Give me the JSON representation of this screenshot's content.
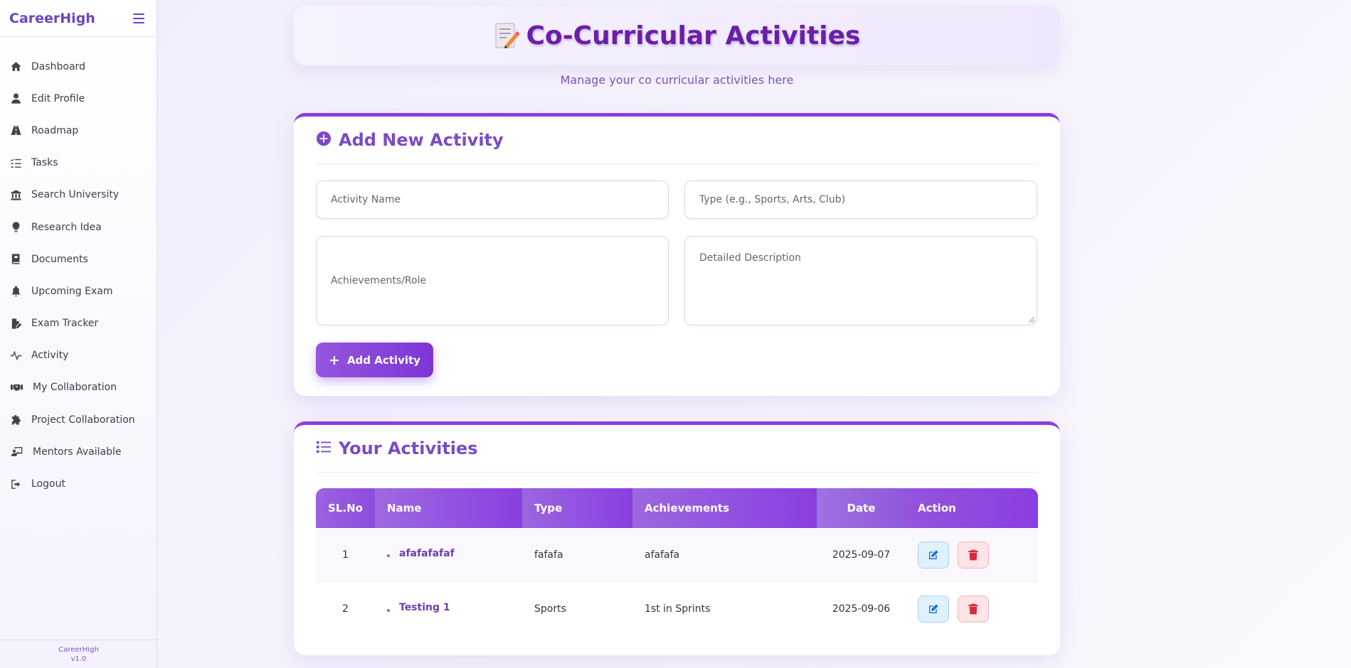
{
  "app": {
    "brand": "CareerHigh",
    "footer_name": "CareerHigh",
    "footer_version": "v1.0"
  },
  "sidebar": {
    "items": [
      {
        "label": "Dashboard",
        "icon": "home-icon"
      },
      {
        "label": "Edit Profile",
        "icon": "user-icon"
      },
      {
        "label": "Roadmap",
        "icon": "road-icon"
      },
      {
        "label": "Tasks",
        "icon": "list-check-icon"
      },
      {
        "label": "Search University",
        "icon": "university-icon"
      },
      {
        "label": "Research Idea",
        "icon": "lightbulb-icon"
      },
      {
        "label": "Documents",
        "icon": "book-icon"
      },
      {
        "label": "Upcoming Exam",
        "icon": "bell-icon"
      },
      {
        "label": "Exam Tracker",
        "icon": "file-signature-icon"
      },
      {
        "label": "Activity",
        "icon": "pulse-icon"
      },
      {
        "label": "My Collaboration",
        "icon": "handshake-icon"
      },
      {
        "label": "Project Collaboration",
        "icon": "puzzle-icon"
      },
      {
        "label": "Mentors Available",
        "icon": "chalkboard-teacher-icon"
      },
      {
        "label": "Logout",
        "icon": "logout-icon"
      }
    ]
  },
  "page": {
    "title": "Co-Curricular Activities",
    "subtitle": "Manage your co curricular activities here"
  },
  "form": {
    "heading": "Add New Activity",
    "name_placeholder": "Activity Name",
    "type_placeholder": "Type (e.g., Sports, Arts, Club)",
    "achievements_placeholder": "Achievements/Role",
    "description_placeholder": "Detailed Description",
    "submit_label": "Add Activity"
  },
  "activities": {
    "heading": "Your Activities",
    "columns": [
      "SL.No",
      "Name",
      "Type",
      "Achievements",
      "Date",
      "Action"
    ],
    "rows": [
      {
        "sl": "1",
        "name": "afafafafaf",
        "type": "fafafa",
        "achievements": "afafafa",
        "date": "2025-09-07"
      },
      {
        "sl": "2",
        "name": "Testing 1",
        "type": "Sports",
        "achievements": "1st in Sprints",
        "date": "2025-09-06"
      }
    ]
  },
  "colors": {
    "accent": "#8a3ee0",
    "brand": "#6f42c1",
    "edit": "#1f6fd1",
    "delete": "#d82a3a"
  }
}
